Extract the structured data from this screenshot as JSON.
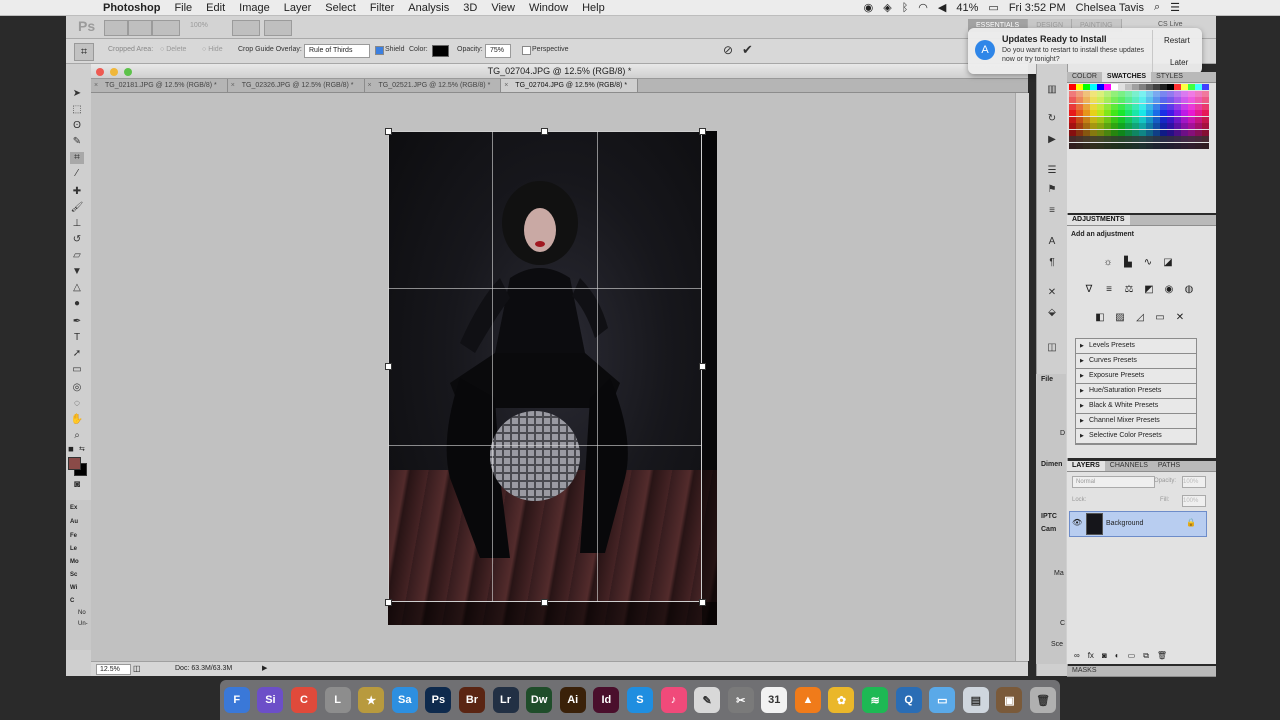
{
  "menubar": {
    "app_name": "Photoshop",
    "items": [
      "File",
      "Edit",
      "Image",
      "Layer",
      "Select",
      "Filter",
      "Analysis",
      "3D",
      "View",
      "Window",
      "Help"
    ],
    "battery": "41%",
    "clock": "Fri 3:52 PM",
    "user": "Chelsea Tavis"
  },
  "appbar": {
    "logo": "Ps",
    "zoom": "100%",
    "workspace_tabs": [
      "ESSENTIALS",
      "DESIGN",
      "PAINTING"
    ],
    "cs_live": "CS Live"
  },
  "options": {
    "cropped_area_label": "Cropped Area:",
    "delete_label": "Delete",
    "hide_label": "Hide",
    "overlay_label": "Crop Guide Overlay:",
    "overlay_value": "Rule of Thirds",
    "shield_label": "Shield",
    "color_label": "Color:",
    "opacity_label": "Opacity:",
    "opacity_value": "75%",
    "perspective_label": "Perspective"
  },
  "document": {
    "title": "TG_02704.JPG @ 12.5% (RGB/8) *",
    "tabs": [
      "TG_02181.JPG @ 12.5% (RGB/8) *",
      "TG_02326.JPG @ 12.5% (RGB/8) *",
      "TG_02521.JPG @ 12.5% (RGB/8) *",
      "TG_02704.JPG @ 12.5% (RGB/8) *"
    ],
    "zoom": "12.5%",
    "doc_size": "Doc: 63.3M/63.3M"
  },
  "notification": {
    "title": "Updates Ready to Install",
    "body": "Do you want to restart to install these updates now or try tonight?",
    "restart": "Restart",
    "later": "Later"
  },
  "panels": {
    "color_tabs": [
      "COLOR",
      "SWATCHES",
      "STYLES"
    ],
    "adjustments_title": "ADJUSTMENTS",
    "add_adjustment": "Add an adjustment",
    "presets": [
      "Levels Presets",
      "Curves Presets",
      "Exposure Presets",
      "Hue/Saturation Presets",
      "Black & White Presets",
      "Channel Mixer Presets",
      "Selective Color Presets"
    ],
    "layers_tabs": [
      "LAYERS",
      "CHANNELS",
      "PATHS"
    ],
    "blend_mode": "Normal",
    "opacity_label": "Opacity:",
    "opacity_value": "100%",
    "lock_label": "Lock:",
    "fill_label": "Fill:",
    "fill_value": "100%",
    "layer_name": "Background",
    "masks_label": "MASKS",
    "file_info_label": "File",
    "dimen_label": "Dimen",
    "iptc_label": "IPTC",
    "cam_label": "Cam",
    "side_letters": [
      "D",
      "Ma",
      "C",
      "Sce"
    ]
  },
  "left_panel": {
    "items": [
      "Ex",
      "Au",
      "Fe",
      "Le",
      "Mo",
      "Sc",
      "Wi",
      "C"
    ],
    "no_label": "No",
    "un_label": "Un-"
  },
  "swatch_colors": [
    "#ff0000",
    "#ffff00",
    "#00ff00",
    "#00ffff",
    "#0000ff",
    "#ff00ff",
    "#ffffff",
    "#e0e0e0",
    "#c0c0c0",
    "#a0a0a0",
    "#808080",
    "#606060",
    "#404040",
    "#202020",
    "#000000",
    "#ff3030",
    "#ffff40",
    "#40ff40",
    "#40ffff",
    "#4040ff"
  ],
  "dock": [
    {
      "label": "F",
      "color": "#3a78d8"
    },
    {
      "label": "Si",
      "color": "#6c4fc8"
    },
    {
      "label": "C",
      "color": "#e04a3b"
    },
    {
      "label": "L",
      "color": "#8d8d8d"
    },
    {
      "label": "★",
      "color": "#b89a3e"
    },
    {
      "label": "Sa",
      "color": "#2d8fe0"
    },
    {
      "label": "Ps",
      "color": "#0e2a4d"
    },
    {
      "label": "Br",
      "color": "#5a2513"
    },
    {
      "label": "Lr",
      "color": "#223044"
    },
    {
      "label": "Dw",
      "color": "#1f4d2a"
    },
    {
      "label": "Ai",
      "color": "#3a2109"
    },
    {
      "label": "Id",
      "color": "#4a0f2c"
    },
    {
      "label": "S",
      "color": "#1f8ee0"
    },
    {
      "label": "♪",
      "color": "#f04a7a"
    },
    {
      "label": "✎",
      "color": "#d8d8d8"
    },
    {
      "label": "✂",
      "color": "#7a7a7a"
    },
    {
      "label": "31",
      "color": "#f2f2f2"
    },
    {
      "label": "▲",
      "color": "#f07b1a"
    },
    {
      "label": "✿",
      "color": "#eab72a"
    },
    {
      "label": "≋",
      "color": "#1db954"
    },
    {
      "label": "Q",
      "color": "#2a6db5"
    },
    {
      "label": "▭",
      "color": "#5aa9e8"
    },
    {
      "label": "▤",
      "color": "#cfd6de"
    },
    {
      "label": "▣",
      "color": "#7a5a3a"
    },
    {
      "label": "🗑",
      "color": "#b0b0b0"
    }
  ]
}
